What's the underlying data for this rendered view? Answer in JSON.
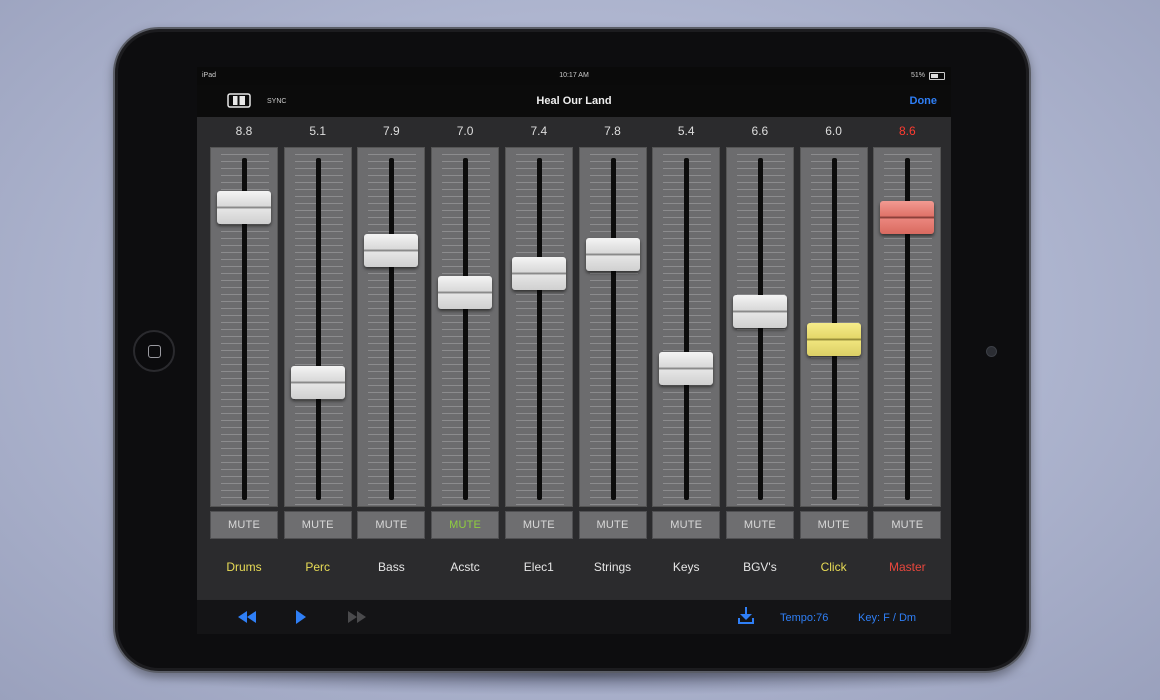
{
  "status": {
    "device": "iPad",
    "time": "10:17 AM",
    "battery": "51%"
  },
  "nav": {
    "sync_label": "SYNC",
    "title": "Heal Our Land",
    "done_label": "Done"
  },
  "colors": {
    "accent": "#2f7ff6",
    "label_yellow": "#e8dc56",
    "label_red": "#e8473d",
    "mute_active": "#8fcf3f",
    "value_red": "#ff3b30"
  },
  "channels": [
    {
      "name": "Drums",
      "value": "8.8",
      "level": 0.88,
      "mute": "MUTE",
      "name_color": "yellow",
      "thumb": "white"
    },
    {
      "name": "Perc",
      "value": "5.1",
      "level": 0.51,
      "mute": "MUTE",
      "name_color": "yellow",
      "thumb": "white"
    },
    {
      "name": "Bass",
      "value": "7.9",
      "level": 0.79,
      "mute": "MUTE",
      "name_color": "white",
      "thumb": "white"
    },
    {
      "name": "Acstc",
      "value": "7.0",
      "level": 0.7,
      "mute": "MUTE",
      "name_color": "white",
      "thumb": "white",
      "muted": true
    },
    {
      "name": "Elec1",
      "value": "7.4",
      "level": 0.74,
      "mute": "MUTE",
      "name_color": "white",
      "thumb": "white"
    },
    {
      "name": "Strings",
      "value": "7.8",
      "level": 0.78,
      "mute": "MUTE",
      "name_color": "white",
      "thumb": "white"
    },
    {
      "name": "Keys",
      "value": "5.4",
      "level": 0.54,
      "mute": "MUTE",
      "name_color": "white",
      "thumb": "white"
    },
    {
      "name": "BGV's",
      "value": "6.6",
      "level": 0.66,
      "mute": "MUTE",
      "name_color": "white",
      "thumb": "white"
    },
    {
      "name": "Click",
      "value": "6.0",
      "level": 0.6,
      "mute": "MUTE",
      "name_color": "yellow",
      "thumb": "yellow"
    },
    {
      "name": "Master",
      "value": "8.6",
      "level": 0.86,
      "mute": "MUTE",
      "name_color": "red",
      "thumb": "red",
      "value_red": true
    }
  ],
  "toolbar": {
    "rewind_icon": "rewind-icon",
    "play_icon": "play-icon",
    "fast_forward_icon": "fast-forward-icon",
    "download_icon": "download-icon",
    "tempo": "Tempo:76",
    "key": "Key: F / Dm"
  }
}
